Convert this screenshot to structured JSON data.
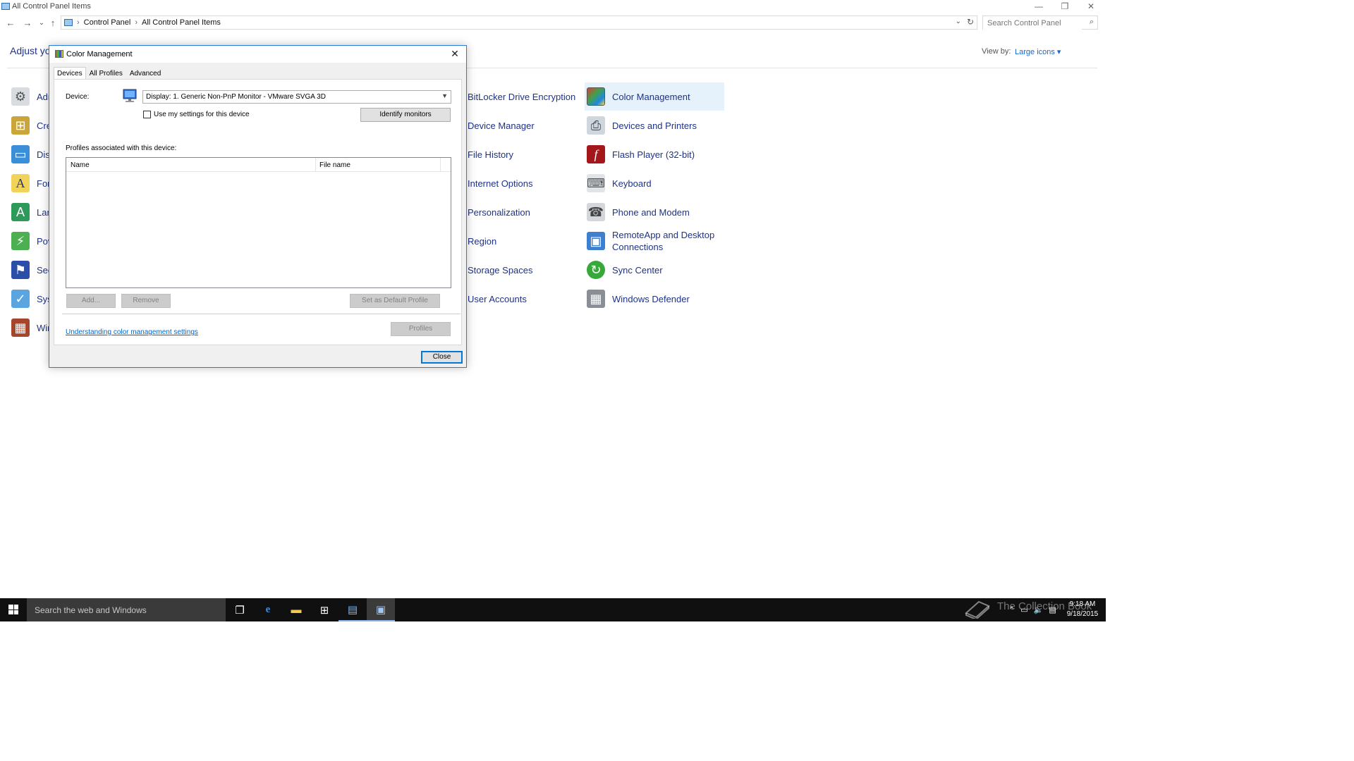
{
  "window": {
    "title": "All Control Panel Items",
    "controls": {
      "minimize": "—",
      "restore": "❐",
      "close": "✕"
    }
  },
  "nav": {
    "back": "←",
    "forward": "→",
    "recent": "⌄",
    "up": "↑",
    "breadcrumb": [
      "Control Panel",
      "All Control Panel Items"
    ],
    "search_placeholder": "Search Control Panel"
  },
  "header": {
    "adjust_text": "Adjust yo",
    "view_by_label": "View by:",
    "view_by_value": "Large icons ▾"
  },
  "left_items": [
    {
      "label": "Adr",
      "icon": "admin-tools-icon"
    },
    {
      "label": "Cre",
      "icon": "credential-manager-icon"
    },
    {
      "label": "Dis",
      "icon": "display-icon"
    },
    {
      "label": "For",
      "icon": "fonts-icon"
    },
    {
      "label": "Lar",
      "icon": "language-icon"
    },
    {
      "label": "Pov",
      "icon": "power-options-icon"
    },
    {
      "label": "Sec",
      "icon": "security-maintenance-icon"
    },
    {
      "label": "Sys",
      "icon": "system-icon"
    },
    {
      "label": "Wir",
      "icon": "windows-firewall-icon"
    }
  ],
  "middle_items": [
    {
      "label": "BitLocker Drive Encryption"
    },
    {
      "label": "Device Manager"
    },
    {
      "label": "File History"
    },
    {
      "label": "Internet Options"
    },
    {
      "label": "Personalization"
    },
    {
      "label": "Region"
    },
    {
      "label": "Storage Spaces"
    },
    {
      "label": "User Accounts"
    }
  ],
  "right_items": [
    {
      "label": "Color Management",
      "icon": "color-management-icon",
      "selected": true
    },
    {
      "label": "Devices and Printers",
      "icon": "devices-printers-icon"
    },
    {
      "label": "Flash Player (32-bit)",
      "icon": "flash-player-icon"
    },
    {
      "label": "Keyboard",
      "icon": "keyboard-icon"
    },
    {
      "label": "Phone and Modem",
      "icon": "phone-modem-icon"
    },
    {
      "label": "RemoteApp and Desktop Connections",
      "icon": "remoteapp-icon"
    },
    {
      "label": "Sync Center",
      "icon": "sync-center-icon"
    },
    {
      "label": "Windows Defender",
      "icon": "windows-defender-icon"
    }
  ],
  "dialog": {
    "title": "Color Management",
    "close": "✕",
    "tabs": [
      "Devices",
      "All Profiles",
      "Advanced"
    ],
    "device_label": "Device:",
    "device_value": "Display: 1. Generic Non-PnP Monitor - VMware SVGA 3D",
    "use_my_settings": "Use my settings for this device",
    "identify_monitors": "Identify monitors",
    "profiles_label": "Profiles associated with this device:",
    "columns": [
      "Name",
      "File name"
    ],
    "add": "Add...",
    "remove": "Remove",
    "set_default": "Set as Default Profile",
    "help_link": "Understanding color management settings",
    "profiles_button": "Profiles",
    "close_button": "Close"
  },
  "taskbar": {
    "search_text": "Search the web and Windows",
    "clock_time": "9:18 AM",
    "clock_date": "9/18/2015",
    "watermark": "The Collection Book"
  },
  "colors": {
    "link": "#1e3287",
    "selection": "#e5f1fb",
    "accent": "#0078d7",
    "taskbar": "#101010"
  }
}
